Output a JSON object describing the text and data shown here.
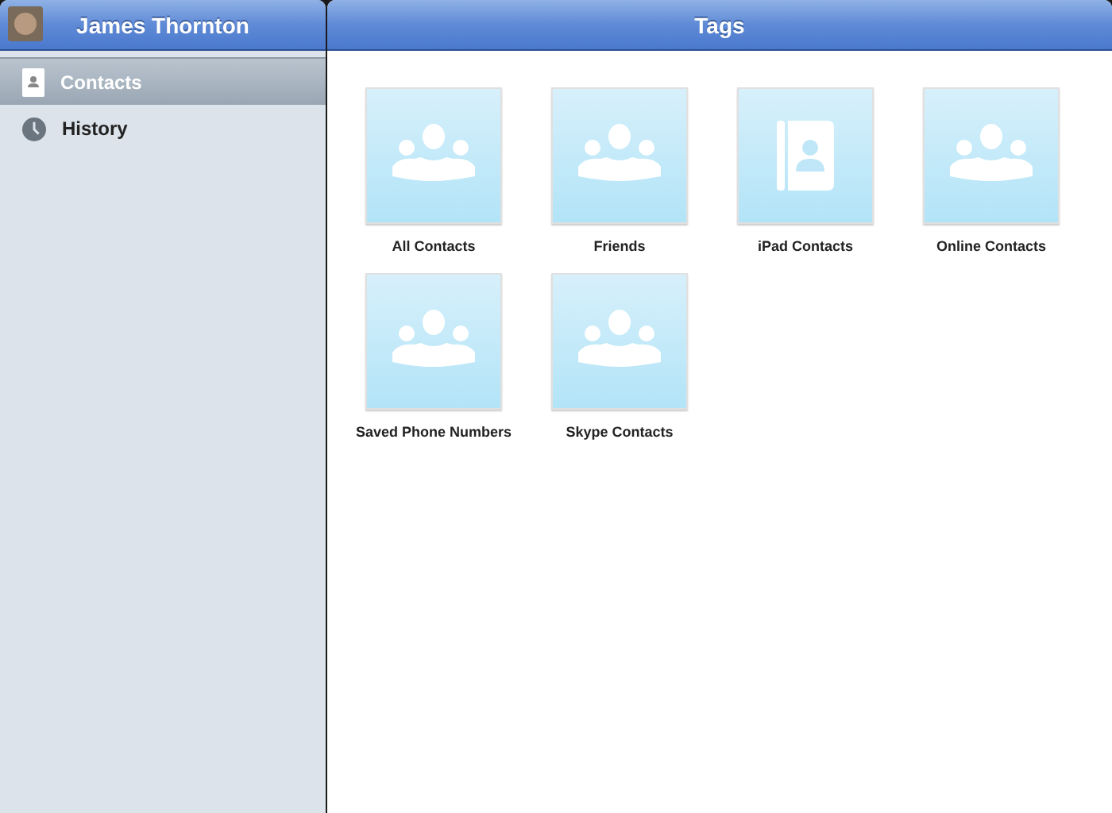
{
  "sidebar": {
    "title": "James Thornton",
    "items": [
      {
        "label": "Contacts",
        "kind": "contacts",
        "selected": true
      },
      {
        "label": "History",
        "kind": "history",
        "selected": false
      }
    ]
  },
  "main": {
    "title": "Tags",
    "tiles": [
      {
        "label": "All Contacts",
        "kind": "group"
      },
      {
        "label": "Friends",
        "kind": "group"
      },
      {
        "label": "iPad Contacts",
        "kind": "addressbook"
      },
      {
        "label": "Online Contacts",
        "kind": "group"
      },
      {
        "label": "Saved Phone Numbers",
        "kind": "group"
      },
      {
        "label": "Skype Contacts",
        "kind": "group"
      }
    ]
  }
}
